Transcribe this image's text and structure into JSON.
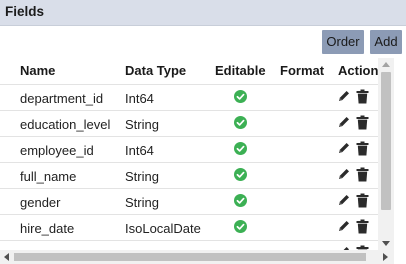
{
  "panel": {
    "title": "Fields"
  },
  "toolbar": {
    "order_label": "Order",
    "add_label": "Add"
  },
  "table": {
    "headers": [
      "Name",
      "Data Type",
      "Editable",
      "Format",
      "Action"
    ],
    "rows": [
      {
        "name": "department_id",
        "type": "Int64",
        "editable": true,
        "format": ""
      },
      {
        "name": "education_level",
        "type": "String",
        "editable": true,
        "format": ""
      },
      {
        "name": "employee_id",
        "type": "Int64",
        "editable": true,
        "format": ""
      },
      {
        "name": "full_name",
        "type": "String",
        "editable": true,
        "format": ""
      },
      {
        "name": "gender",
        "type": "String",
        "editable": true,
        "format": ""
      },
      {
        "name": "hire_date",
        "type": "IsoLocalDate",
        "editable": true,
        "format": ""
      }
    ]
  },
  "colors": {
    "header_bg": "#d9dee9",
    "button_bg": "#8c9bb5",
    "check_green": "#3cb054",
    "icon_dark": "#2b2b2b"
  },
  "icons": {
    "editable": "check-circle-icon",
    "edit": "pencil-icon",
    "delete": "trash-icon"
  }
}
